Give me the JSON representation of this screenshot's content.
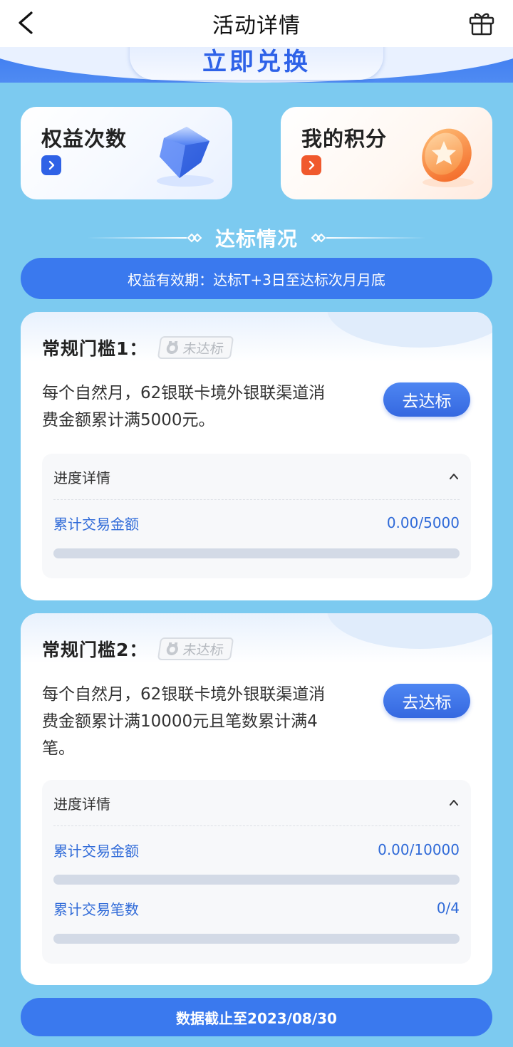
{
  "nav": {
    "title": "活动详情",
    "back_icon": "chevron-left-icon",
    "gift_icon": "gift-icon"
  },
  "hero": {
    "button_label": "立即兑换"
  },
  "cards": {
    "rights": {
      "title": "权益次数",
      "icon": "diamond-icon"
    },
    "points": {
      "title": "我的积分",
      "icon": "coin-icon"
    }
  },
  "section": {
    "title": "达标情况",
    "validity": "权益有效期：达标T+3日至达标次月月底"
  },
  "thresholds": [
    {
      "title": "常规门槛1：",
      "badge": "未达标",
      "description": "每个自然月，62银联卡境外银联渠道消费金额累计满5000元。",
      "button": "去达标",
      "progress_title": "进度详情",
      "rows": [
        {
          "label": "累计交易金额",
          "value": "0.00/5000",
          "progress": 0
        }
      ]
    },
    {
      "title": "常规门槛2：",
      "badge": "未达标",
      "description": "每个自然月，62银联卡境外银联渠道消费金额累计满10000元且笔数累计满4笔。",
      "button": "去达标",
      "progress_title": "进度详情",
      "rows": [
        {
          "label": "累计交易金额",
          "value": "0.00/10000",
          "progress": 0
        },
        {
          "label": "累计交易笔数",
          "value": "0/4",
          "progress": 0
        }
      ]
    }
  ],
  "footer": {
    "data_cutoff": "数据截止至2023/08/30"
  },
  "colors": {
    "page_bg": "#7ccaf0",
    "primary": "#3a79ee",
    "orange": "#f0592d"
  }
}
